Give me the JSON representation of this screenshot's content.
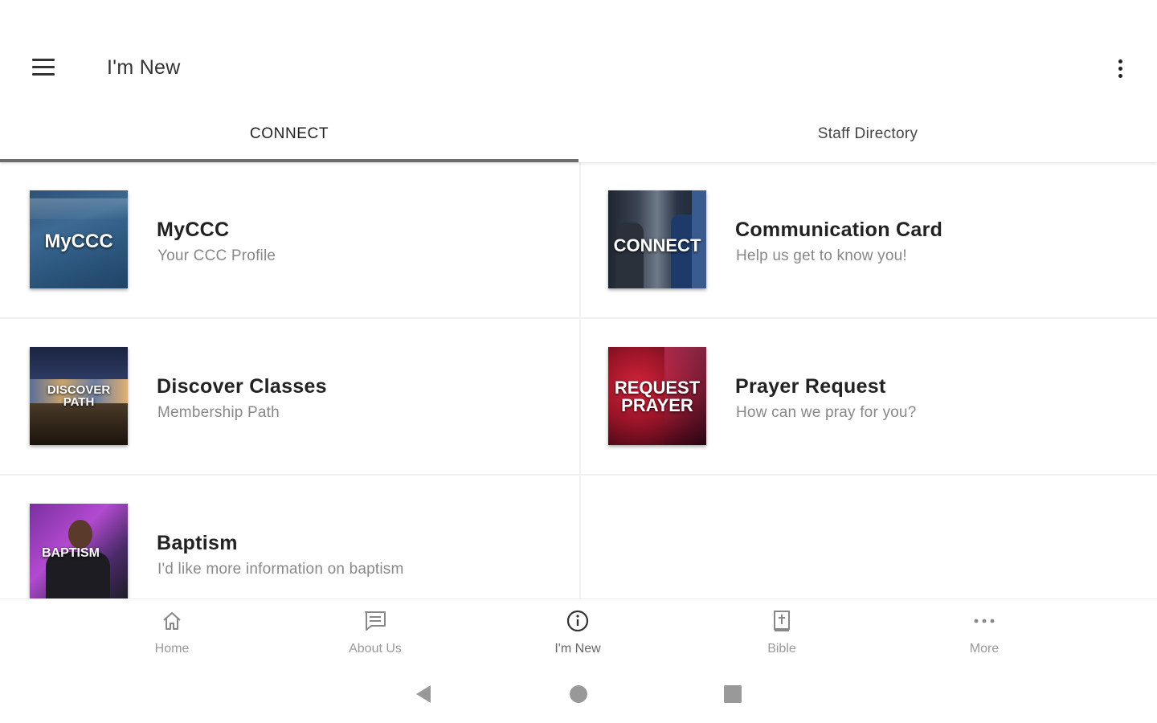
{
  "app_bar": {
    "title": "I'm New",
    "menu_icon": "hamburger-menu-icon",
    "overflow_icon": "more-vertical-icon"
  },
  "tabs": [
    {
      "label": "CONNECT",
      "selected": true
    },
    {
      "label": "Staff Directory",
      "selected": false
    }
  ],
  "cards": [
    {
      "title": "MyCCC",
      "subtitle": "Your CCC Profile",
      "thumb_text": "MyCCC"
    },
    {
      "title": "Communication Card",
      "subtitle": "Help us get to know you!",
      "thumb_text": "CONNECT"
    },
    {
      "title": "Discover Classes",
      "subtitle": "Membership Path",
      "thumb_text": "DISCOVER PATH"
    },
    {
      "title": "Prayer Request",
      "subtitle": "How can we pray for you?",
      "thumb_text": "REQUEST PRAYER"
    },
    {
      "title": "Baptism",
      "subtitle": "I'd like more information on baptism",
      "thumb_text": "BAPTISM"
    }
  ],
  "bottom_nav": [
    {
      "label": "Home",
      "icon": "home-icon",
      "active": false
    },
    {
      "label": "About Us",
      "icon": "message-icon",
      "active": false
    },
    {
      "label": "I'm New",
      "icon": "info-icon",
      "active": true
    },
    {
      "label": "Bible",
      "icon": "bible-icon",
      "active": false
    },
    {
      "label": "More",
      "icon": "more-horizontal-icon",
      "active": false
    }
  ],
  "system_nav": [
    "back-icon",
    "home-circle-icon",
    "recents-icon"
  ],
  "colors": {
    "tab_indicator": "#6b6b6b",
    "text_primary": "#222222",
    "text_secondary": "#888888",
    "nav_label": "#999999"
  }
}
